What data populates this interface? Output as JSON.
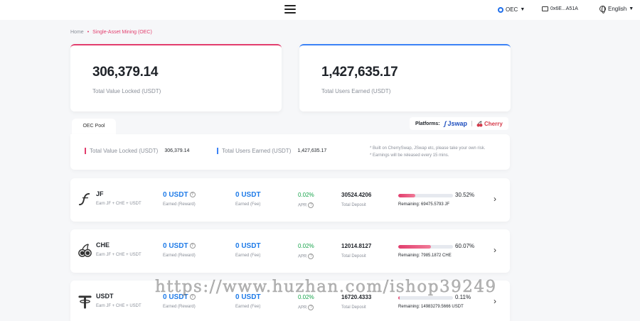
{
  "header": {
    "network": "OEC",
    "wallet": "0x6E...A51A",
    "language": "English"
  },
  "breadcrumb": {
    "home": "Home",
    "separator": "•",
    "current": "Single-Asset Mining (OEC)"
  },
  "stats": {
    "tvl_value": "306,379.14",
    "tvl_label": "Total Value Locked (USDT)",
    "earned_value": "1,427,635.17",
    "earned_label": "Total Users Earned (USDT)"
  },
  "pool_tab": "OEC Pool",
  "platforms": {
    "label": "Platforms:",
    "jswap": "Jswap",
    "cherry": "Cherry"
  },
  "summary": {
    "tvl_label": "Total Value Locked (USDT)",
    "tvl_value": "306,379.14",
    "earned_label": "Total Users Earned (USDT)",
    "earned_value": "1,427,635.17",
    "note1": "* Built on CherrySwap, JSwap etc, please take your own risk.",
    "note2": "* Earnings will be released every 15 mins."
  },
  "pools": [
    {
      "icon": "jf-icon",
      "name": "JF",
      "earn": "Earn JF + CHE + USDT",
      "reward": "0 USDT",
      "reward_label": "Earned (Reward)",
      "fee": "0 USDT",
      "fee_label": "Earned (Fee)",
      "apr": "0.02%",
      "apr_label": "APR",
      "deposit": "30524.4206",
      "deposit_label": "Total Deposit",
      "progress": 0.3052,
      "pct": "30.52%",
      "remaining_label": "Remaining:",
      "remaining": "69475.5793 JF"
    },
    {
      "icon": "cherry-icon",
      "name": "CHE",
      "earn": "Earn JF + CHE + USDT",
      "reward": "0 USDT",
      "reward_label": "Earned (Reward)",
      "fee": "0 USDT",
      "fee_label": "Earned (Fee)",
      "apr": "0.02%",
      "apr_label": "APR",
      "deposit": "12014.8127",
      "deposit_label": "Total Deposit",
      "progress": 0.6007,
      "pct": "60.07%",
      "remaining_label": "Remaining:",
      "remaining": "7985.1872 CHE"
    },
    {
      "icon": "tether-icon",
      "name": "USDT",
      "earn": "Earn JF + CHE + USDT",
      "reward": "0 USDT",
      "reward_label": "Earned (Reward)",
      "fee": "0 USDT",
      "fee_label": "Earned (Fee)",
      "apr": "0.02%",
      "apr_label": "APR",
      "deposit": "16720.4333",
      "deposit_label": "Total Deposit",
      "progress": 0.0011,
      "pct": "0.11%",
      "remaining_label": "Remaining:",
      "remaining": "14983279.5666 USDT"
    }
  ],
  "watermark": "https://www.huzhan.com/ishop39249",
  "colors": {
    "accent_pink": "#e23d6d",
    "accent_blue": "#3b82f6",
    "amount_blue": "#1f7be8",
    "apr_green": "#16a34a"
  }
}
